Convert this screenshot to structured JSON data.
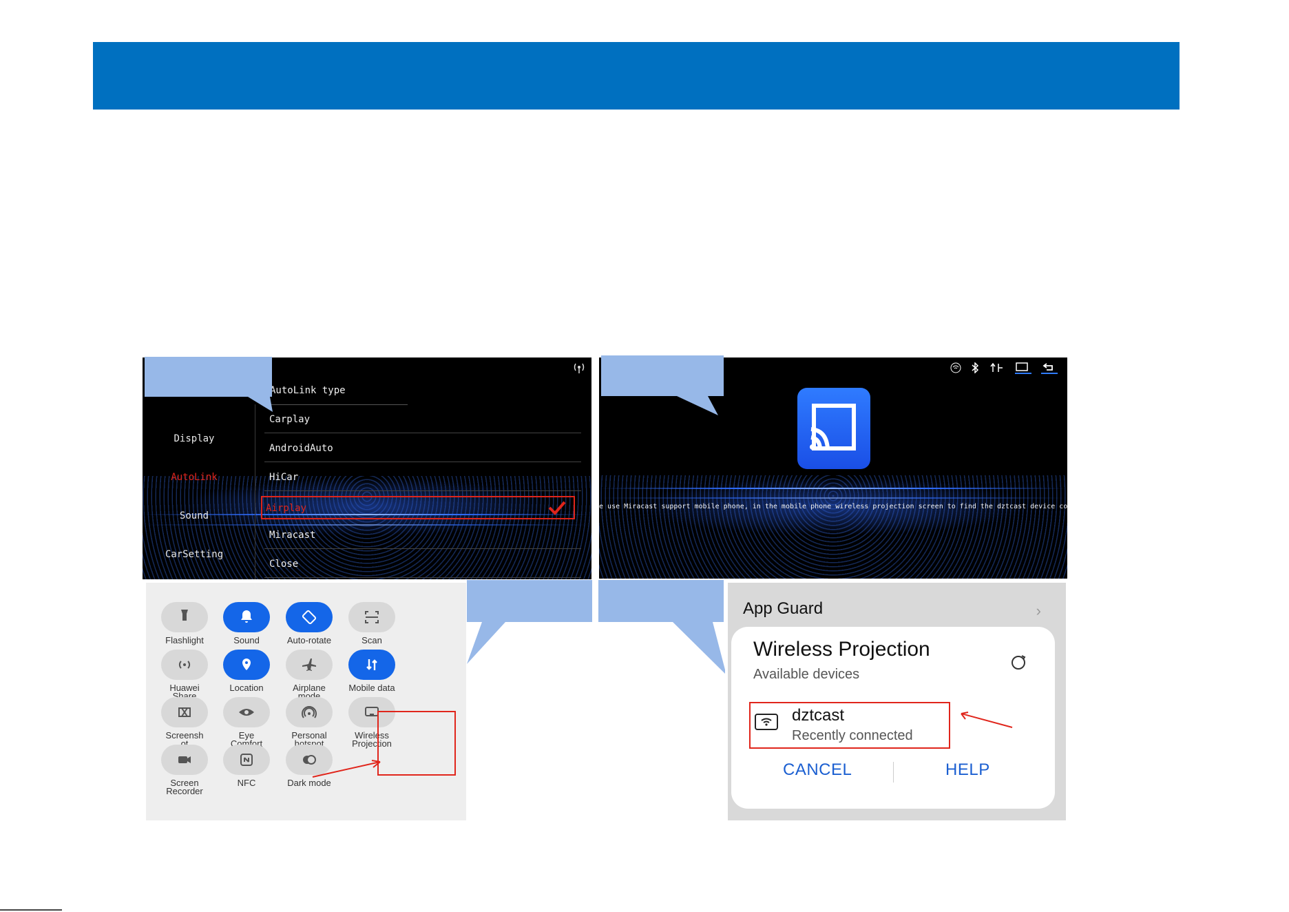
{
  "autolink_panel": {
    "sidebar": [
      "Display",
      "AutoLink",
      "Sound",
      "CarSetting"
    ],
    "active_sidebar": "AutoLink",
    "section_title": "AutoLink type",
    "options": [
      "Carplay",
      "AndroidAuto",
      "HiCar",
      "Airplay",
      "Miracast",
      "Close"
    ],
    "selected_option": "Airplay"
  },
  "miracast_panel": {
    "hint": "se use Miracast support mobile phone, in the mobile phone wireless projection screen to find the dztcast device connect"
  },
  "quick_settings": {
    "tiles": [
      {
        "label": "Flashlight",
        "on": false,
        "icon": "flashlight-icon"
      },
      {
        "label": "Sound",
        "on": true,
        "icon": "bell-icon"
      },
      {
        "label": "Auto-rotate",
        "on": true,
        "icon": "rotate-icon"
      },
      {
        "label": "Scan",
        "on": false,
        "icon": "scan-icon"
      },
      {
        "label": "Huawei\nShare",
        "on": false,
        "icon": "share-wave-icon"
      },
      {
        "label": "Location",
        "on": true,
        "icon": "location-icon"
      },
      {
        "label": "Airplane\nmode",
        "on": false,
        "icon": "airplane-icon"
      },
      {
        "label": "Mobile data",
        "on": true,
        "icon": "mobile-data-icon"
      },
      {
        "label": "Screensh\not",
        "on": false,
        "icon": "screenshot-icon"
      },
      {
        "label": "Eye\nComfort",
        "on": false,
        "icon": "eye-icon"
      },
      {
        "label": "Personal\nhotspot",
        "on": false,
        "icon": "hotspot-icon"
      },
      {
        "label": "Wireless\nProjection",
        "on": false,
        "icon": "projection-icon"
      },
      {
        "label": "Screen\nRecorder",
        "on": false,
        "icon": "recorder-icon"
      },
      {
        "label": "NFC",
        "on": false,
        "icon": "nfc-icon"
      },
      {
        "label": "Dark mode",
        "on": false,
        "icon": "dark-mode-icon"
      }
    ]
  },
  "projection_dialog": {
    "background_item": "App Guard",
    "title": "Wireless Projection",
    "subtitle": "Available devices",
    "device_name": "dztcast",
    "device_status": "Recently connected",
    "cancel_label": "CANCEL",
    "help_label": "HELP"
  },
  "colors": {
    "header": "#0070c0",
    "callout": "#97b8e8",
    "highlight": "#e0251b",
    "toggle_on": "#1466e8",
    "dialog_button": "#1b5fd1"
  }
}
